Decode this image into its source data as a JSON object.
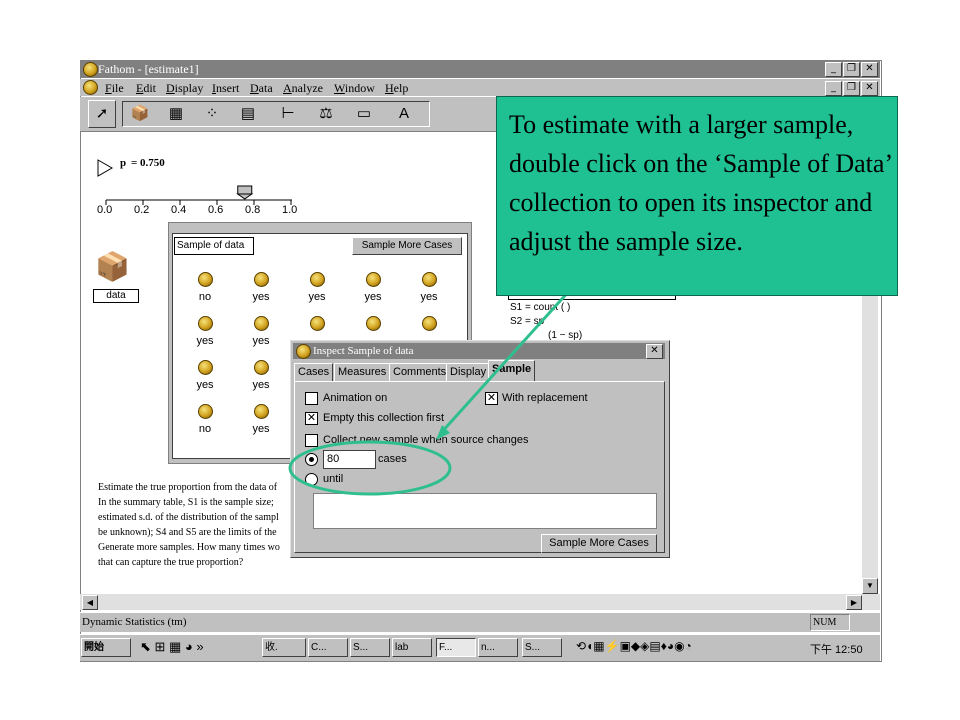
{
  "window": {
    "title": "Fathom - [estimate1]",
    "controls": [
      "_",
      "̵",
      "×"
    ]
  },
  "menu": [
    "File",
    "Edit",
    "Display",
    "Insert",
    "Data",
    "Analyze",
    "Window",
    "Help"
  ],
  "toolbar": {
    "icons": [
      "arrow-icon",
      "collection-box-icon",
      "table-icon",
      "graph-icon",
      "summary-table-icon",
      "estimate-icon",
      "test-icon",
      "model-icon",
      "text-icon"
    ]
  },
  "slider": {
    "label": "p",
    "value_text": "= 0.750",
    "value": 0.75,
    "ticks": [
      "0.0",
      "0.2",
      "0.4",
      "0.6",
      "0.8",
      "1.0"
    ]
  },
  "data_collection": {
    "label": "data"
  },
  "sample_collection": {
    "name": "Sample of data",
    "button": "Sample More Cases",
    "cases": [
      [
        "no",
        "yes",
        "yes",
        "yes",
        "yes"
      ],
      [
        "yes",
        "yes",
        "",
        "",
        ""
      ],
      [
        "yes",
        "yes",
        "",
        "",
        ""
      ],
      [
        "no",
        "yes",
        "",
        "",
        ""
      ]
    ]
  },
  "summary": {
    "lines": [
      "S1 = count (  )",
      "S2 = sp",
      "(1 − sp)"
    ]
  },
  "instructions": [
    "Estimate the true proportion from the data of",
    "In the summary table, S1 is the sample size;",
    "estimated s.d. of the distribution of the sampl",
    "be unknown); S4  and S5 are the limits of the",
    "Generate more samples. How many times wo",
    "that can capture the true proportion?"
  ],
  "inspector": {
    "title": "Inspect Sample of data",
    "tabs": [
      "Cases",
      "Measures",
      "Comments",
      "Display",
      "Sample"
    ],
    "active_tab": "Sample",
    "animation_label": "Animation on",
    "replacement_label": "With replacement",
    "empty_label": "Empty this collection first",
    "collect_label": "Collect new sample when source changes",
    "cases_value": "80",
    "cases_label": "cases",
    "until_label": "until",
    "button": "Sample More Cases"
  },
  "callout": {
    "text": "To estimate with a larger sample, double click on the ‘Sample of Data’ collection to open its inspector and adjust the sample size.",
    "color": "#1fc193"
  },
  "status": {
    "text": "Dynamic Statistics (tm)",
    "num": "NUM"
  },
  "taskbar": {
    "start": "開始",
    "tasks": [
      "收.",
      "C...",
      "S...",
      "lab",
      "F...",
      "n...",
      "S..."
    ],
    "clock": "下午 12:50"
  }
}
